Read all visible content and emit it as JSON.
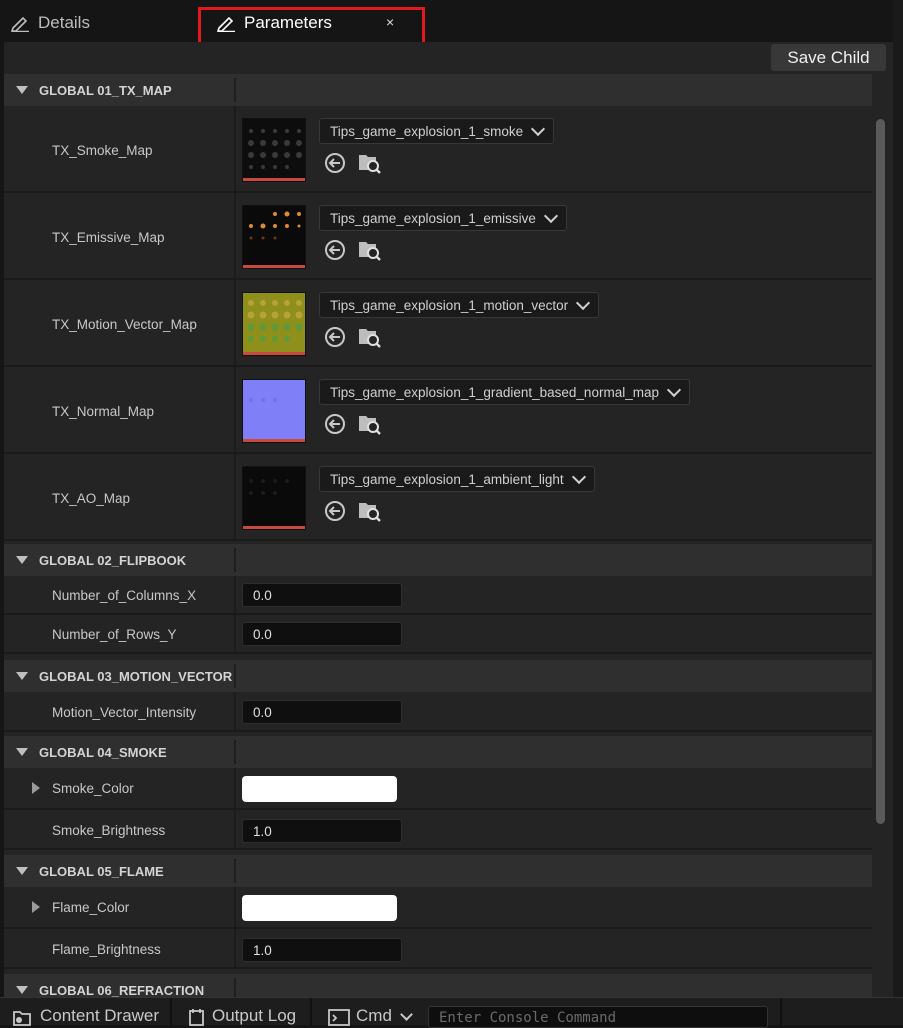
{
  "tabs": {
    "details": "Details",
    "parameters": "Parameters",
    "close": "×"
  },
  "toolbar": {
    "save_child": "Save Child"
  },
  "categories": [
    "GLOBAL 01_TX_MAP",
    "GLOBAL 02_FLIPBOOK",
    "GLOBAL 03_MOTION_VECTOR",
    "GLOBAL 04_SMOKE",
    "GLOBAL 05_FLAME",
    "GLOBAL 06_REFRACTION"
  ],
  "textures": [
    {
      "label": "TX_Smoke_Map",
      "asset": "Tips_game_explosion_1_smoke",
      "thumb_color": "#0d0d0d"
    },
    {
      "label": "TX_Emissive_Map",
      "asset": "Tips_game_explosion_1_emissive",
      "thumb_color": "#0a0a0a"
    },
    {
      "label": "TX_Motion_Vector_Map",
      "asset": "Tips_game_explosion_1_motion_vector",
      "thumb_color": "#8f8f1c"
    },
    {
      "label": "TX_Normal_Map",
      "asset": "Tips_game_explosion_1_gradient_based_normal_map",
      "thumb_color": "#7f7ff8"
    },
    {
      "label": "TX_AO_Map",
      "asset": "Tips_game_explosion_1_ambient_light",
      "thumb_color": "#0a0a0a"
    }
  ],
  "flipbook": {
    "columns_label": "Number_of_Columns_X",
    "columns_value": "0.0",
    "rows_label": "Number_of_Rows_Y",
    "rows_value": "0.0"
  },
  "motion_vector": {
    "label": "Motion_Vector_Intensity",
    "value": "0.0"
  },
  "smoke": {
    "color_label": "Smoke_Color",
    "color_value": "#ffffff",
    "brightness_label": "Smoke_Brightness",
    "brightness_value": "1.0"
  },
  "flame": {
    "color_label": "Flame_Color",
    "color_value": "#ffffff",
    "brightness_label": "Flame_Brightness",
    "brightness_value": "1.0"
  },
  "bottom": {
    "content_drawer": "Content Drawer",
    "output_log": "Output Log",
    "cmd": "Cmd",
    "console_placeholder": "Enter Console Command"
  },
  "colors": {
    "highlight": "#e01a1a",
    "thumb_bar": "#c84a3c"
  }
}
